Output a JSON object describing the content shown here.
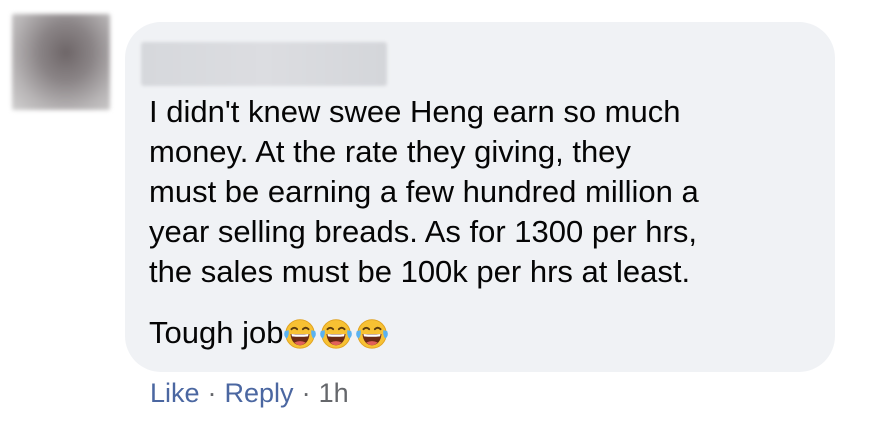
{
  "comment": {
    "author_name": "",
    "text_lines": [
      "I didn't knew swee Heng earn so much",
      "money. At the rate they giving, they",
      "must be earning a few hundred million a",
      "year selling breads. As for 1300 per hrs,",
      "the sales must be 100k per hrs at least."
    ],
    "text_body": "I didn't knew swee Heng earn so much\nmoney. At the rate they giving, they\nmust be earning a few hundred million a\nyear selling breads. As for 1300 per hrs,\nthe sales must be 100k per hrs at least.",
    "tail_text": "Tough job",
    "emojis": [
      "tears-of-joy-icon",
      "tears-of-joy-icon",
      "tears-of-joy-icon"
    ]
  },
  "actions": {
    "like_label": "Like",
    "separator": "·",
    "reply_label": "Reply",
    "timestamp": "1h"
  },
  "colors": {
    "bubble_bg": "#f0f2f5",
    "text": "#050505",
    "link": "#4b67a1",
    "meta": "#65676b"
  }
}
